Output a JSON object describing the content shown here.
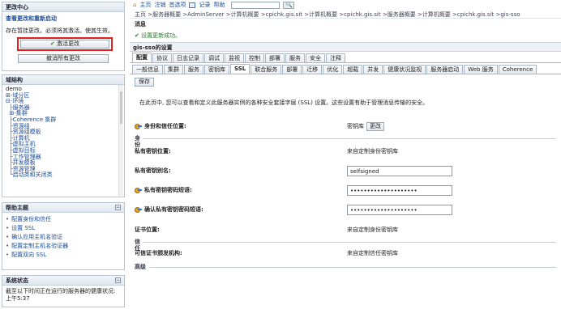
{
  "change_center": {
    "title": "更改中心",
    "link": "查看更改和重新启动",
    "message": "存在暂挂更改。必须将其激活。使其生效。",
    "activate_label": "激活更改",
    "undo_label": "撤消所有更改"
  },
  "domain_structure": {
    "title": "域结构",
    "items": [
      "demo",
      "⊞-域分区",
      "⊟-环境",
      "  ├服务器",
      "  ⊞-集群",
      "  ├Coherence 集群",
      "  ├资源组",
      "  ├资源组模板",
      "  ├计算机",
      "  ├虚拟主机",
      "  ├虚拟目标",
      "  ├工作管理器",
      "  ├并发模板",
      "  ├资源管理",
      "  └启动类和关闭类"
    ]
  },
  "help_topics": {
    "title": "帮助主题",
    "items": [
      "配置身份和信任",
      "设置 SSL",
      "确认应用主机名验证",
      "配置定制主机名验证器",
      "配置双向 SSL"
    ]
  },
  "system_status": {
    "title": "系统状态",
    "text": "截至以下时间正在运行的服务器的健康状况: 上午5:37"
  },
  "topnav": {
    "home": "主页",
    "logout": "注销",
    "prefs": "首选项",
    "record": "记录",
    "help": "帮助",
    "search_icon": "🔍"
  },
  "breadcrumb": "主页 >服务器概要 >AdminServer >计算机概要 >cpichk.gis.sit >计算机概要 >cpichk.gis.sit >服务器概要 >计算机概要 >cpichk.gis.sit >gis-sso",
  "messages": {
    "title": "消息",
    "success": "设置更新成功。"
  },
  "settings": {
    "title": "gis-sso的设置",
    "tabs1": [
      "配置",
      "协议",
      "日志记录",
      "调试",
      "监视",
      "控制",
      "部署",
      "服务",
      "安全",
      "注释"
    ],
    "tabs2": [
      "一般信息",
      "集群",
      "服务",
      "密钥库",
      "SSL",
      "联合服务",
      "部署",
      "迁移",
      "优化",
      "超载",
      "并发",
      "健康状况监视",
      "服务器启动",
      "Web 服务",
      "Coherence"
    ],
    "save_label": "保存",
    "intro": "在此页中, 您可以查看和定义此服务器实例的各种安全套接字层 (SSL) 设置。这些设置有助于管理消息传输的安全。"
  },
  "form": {
    "identity_trust_label": "身份和信任位置:",
    "identity_trust_value": "密钥库",
    "change_label": "更改",
    "identity_section": "身份",
    "pk_location_label": "私有密钥位置:",
    "pk_location_value": "来自定制身份密钥库",
    "pk_alias_label": "私有密钥别名:",
    "pk_alias_value": "selfsigned",
    "pk_pass_label": "私有密钥密码短语:",
    "pk_pass_value": "••••••••••••••••••••",
    "pk_confirm_label": "确认私有密钥密码短语:",
    "pk_confirm_value": "••••••••••••••••••••",
    "cert_location_label": "证书位置:",
    "cert_location_value": "来自定制身份密钥库",
    "trust_section": "信任",
    "trusted_ca_label": "可信证书颁发机构:",
    "trusted_ca_value": "来自定制信任密钥库",
    "advanced_label": "高级"
  }
}
